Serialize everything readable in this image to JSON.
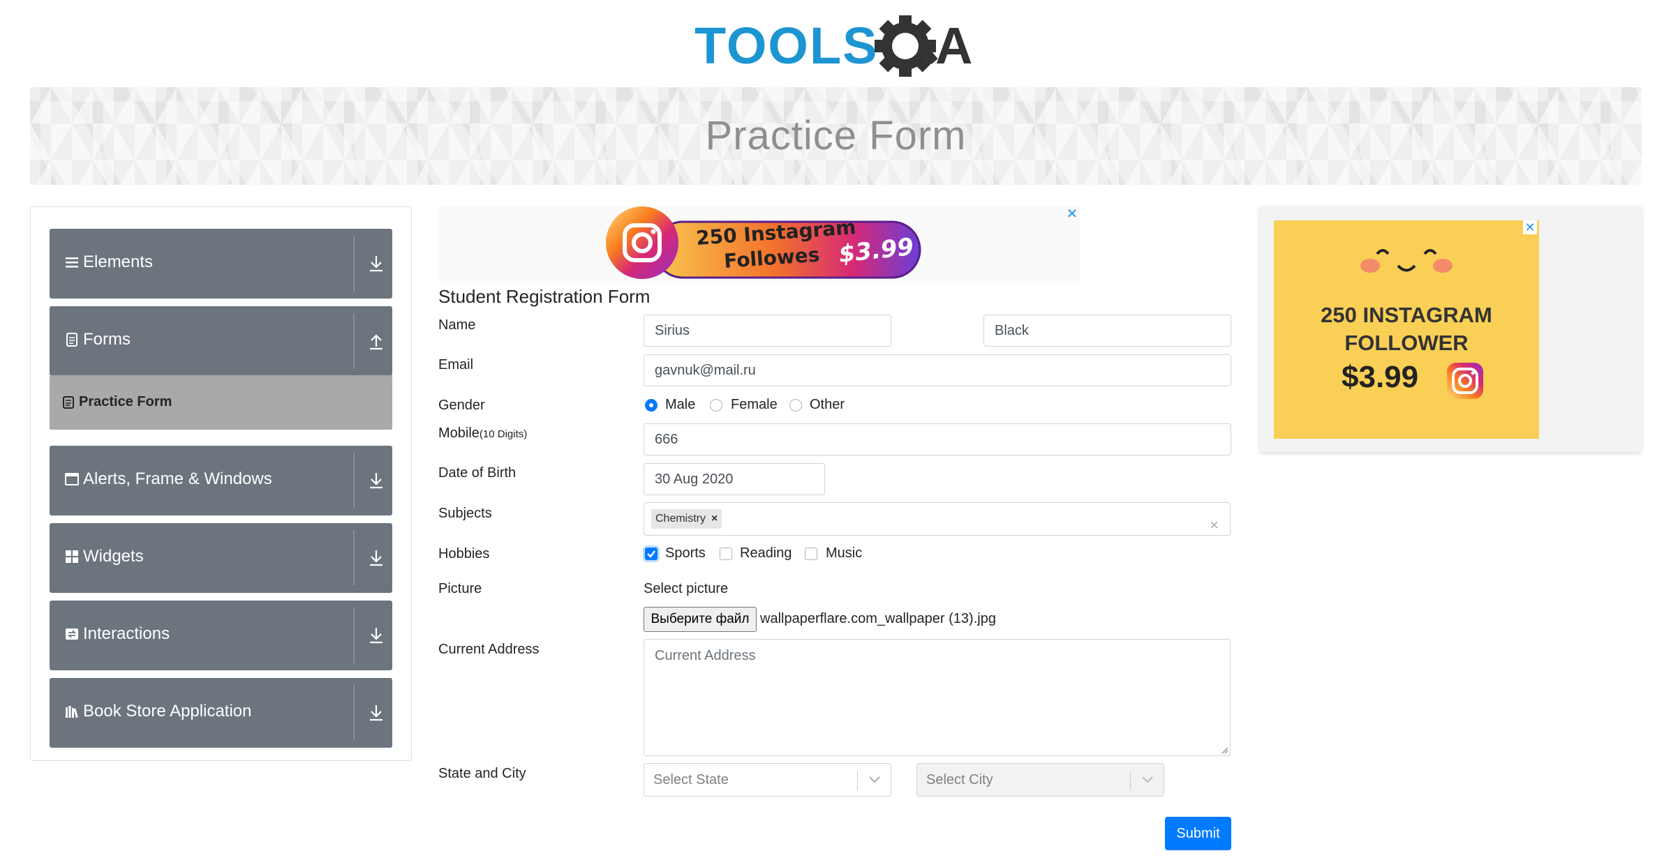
{
  "header": {
    "logo_text_tools": "TOOLS",
    "logo_text_qa": "QA",
    "page_title": "Practice Form"
  },
  "colors": {
    "logo_blue": "#1d95d2",
    "logo_dark": "#333333",
    "sidebar_group_bg": "#6c757d",
    "active_item_bg": "#a9a9a9",
    "primary": "#007bff"
  },
  "sidebar": {
    "groups": [
      {
        "label": "Elements",
        "icon": "list-icon",
        "arrow": "down"
      },
      {
        "label": "Forms",
        "icon": "document-icon",
        "arrow": "up"
      },
      {
        "label": "Alerts, Frame & Windows",
        "icon": "window-icon",
        "arrow": "down"
      },
      {
        "label": "Widgets",
        "icon": "grid-icon",
        "arrow": "down"
      },
      {
        "label": "Interactions",
        "icon": "interactions-icon",
        "arrow": "down"
      },
      {
        "label": "Book Store Application",
        "icon": "books-icon",
        "arrow": "down"
      }
    ],
    "active_item": {
      "label": "Practice Form",
      "icon": "document-icon"
    }
  },
  "ads": {
    "top": {
      "line1": "250 Instagram",
      "line2": "Followes",
      "price": "$3.99",
      "close": "✕"
    },
    "right": {
      "line1": "250 INSTAGRAM",
      "line2": "FOLLOWER",
      "price": "$3.99",
      "close": "✕"
    }
  },
  "form": {
    "title": "Student Registration Form",
    "name": {
      "label": "Name",
      "first": "Sirius",
      "last": "Black"
    },
    "email": {
      "label": "Email",
      "value": "gavnuk@mail.ru"
    },
    "gender": {
      "label": "Gender",
      "options": [
        "Male",
        "Female",
        "Other"
      ],
      "selected": "Male"
    },
    "mobile": {
      "label": "Mobile",
      "hint": "(10 Digits)",
      "value": "666"
    },
    "dob": {
      "label": "Date of Birth",
      "value": "30 Aug 2020"
    },
    "subjects": {
      "label": "Subjects",
      "chips": [
        "Chemistry"
      ],
      "chip_remove": "×",
      "clear": "×"
    },
    "hobbies": {
      "label": "Hobbies",
      "options": [
        "Sports",
        "Reading",
        "Music"
      ],
      "checked": [
        "Sports"
      ]
    },
    "picture": {
      "label": "Picture",
      "caption": "Select picture",
      "button": "Выберите файл",
      "file_name": "wallpaperflare.com_wallpaper (13).jpg"
    },
    "address": {
      "label": "Current Address",
      "placeholder": "Current Address"
    },
    "state_city": {
      "label": "State and City",
      "state_placeholder": "Select State",
      "city_placeholder": "Select City"
    },
    "submit": "Submit"
  }
}
